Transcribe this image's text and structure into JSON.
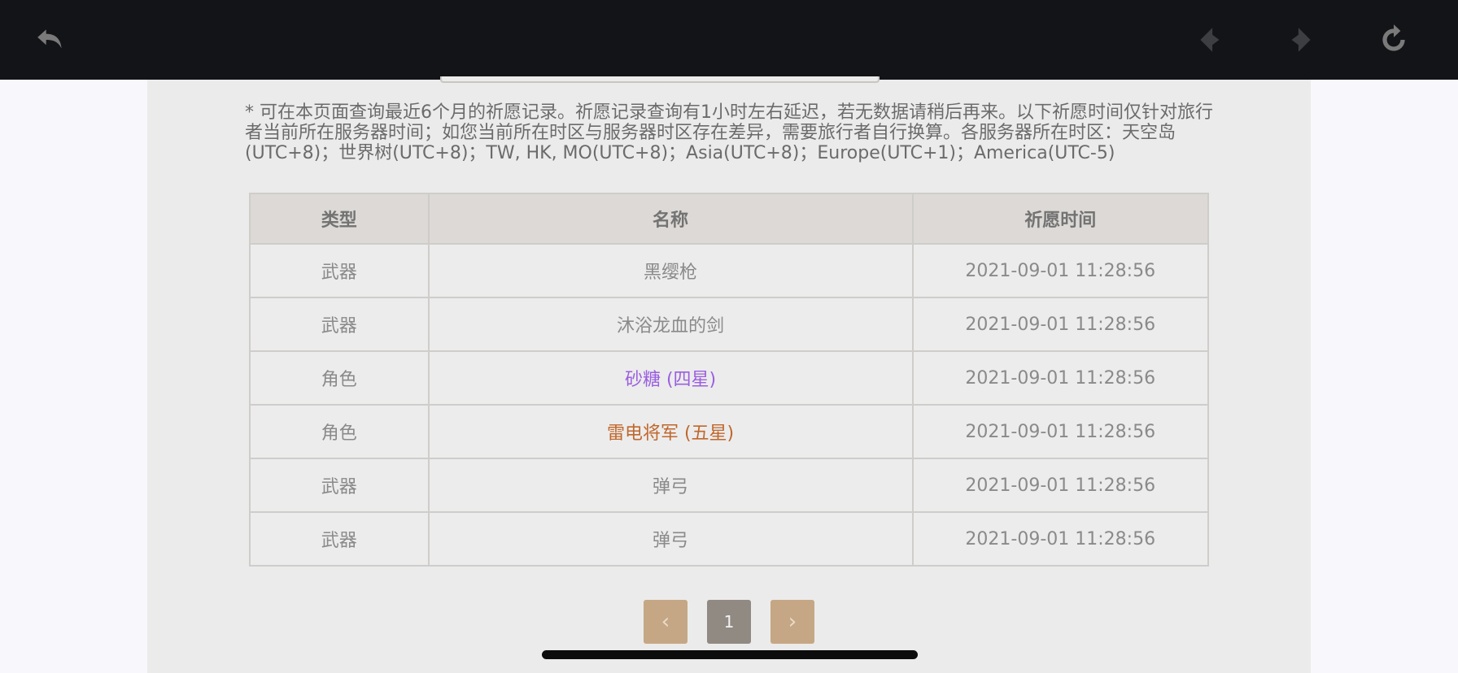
{
  "notice": "* 可在本页面查询最近6个月的祈愿记录。祈愿记录查询有1小时左右延迟，若无数据请稍后再来。以下祈愿时间仅针对旅行者当前所在服务器时间；如您当前所在时区与服务器时区存在差异，需要旅行者自行换算。各服务器所在时区：天空岛(UTC+8)；世界树(UTC+8)；TW, HK, MO(UTC+8)；Asia(UTC+8)；Europe(UTC+1)；America(UTC-5)",
  "table": {
    "headers": [
      "类型",
      "名称",
      "祈愿时间"
    ],
    "rows": [
      {
        "type": "武器",
        "name": "黑缨枪",
        "time": "2021-09-01 11:28:56"
      },
      {
        "type": "武器",
        "name": "沐浴龙血的剑",
        "time": "2021-09-01 11:28:56"
      },
      {
        "type": "角色",
        "name": "砂糖 (四星)",
        "time": "2021-09-01 11:28:56"
      },
      {
        "type": "角色",
        "name": "雷电将军 (五星)",
        "time": "2021-09-01 11:28:56"
      },
      {
        "type": "武器",
        "name": "弹弓",
        "time": "2021-09-01 11:28:56"
      },
      {
        "type": "武器",
        "name": "弹弓",
        "time": "2021-09-01 11:28:56"
      }
    ]
  },
  "pagination": {
    "prev": "‹",
    "current": "1",
    "next": "›"
  },
  "icons": {
    "back": "back-arrow-icon",
    "prev": "prev-diamond-icon",
    "next": "next-diamond-icon",
    "reload": "reload-icon"
  },
  "colors": {
    "four_star": "#9b5fe0",
    "five_star": "#c0672c",
    "pager_arrow": "#c6a785",
    "pager_current": "#918a83"
  }
}
